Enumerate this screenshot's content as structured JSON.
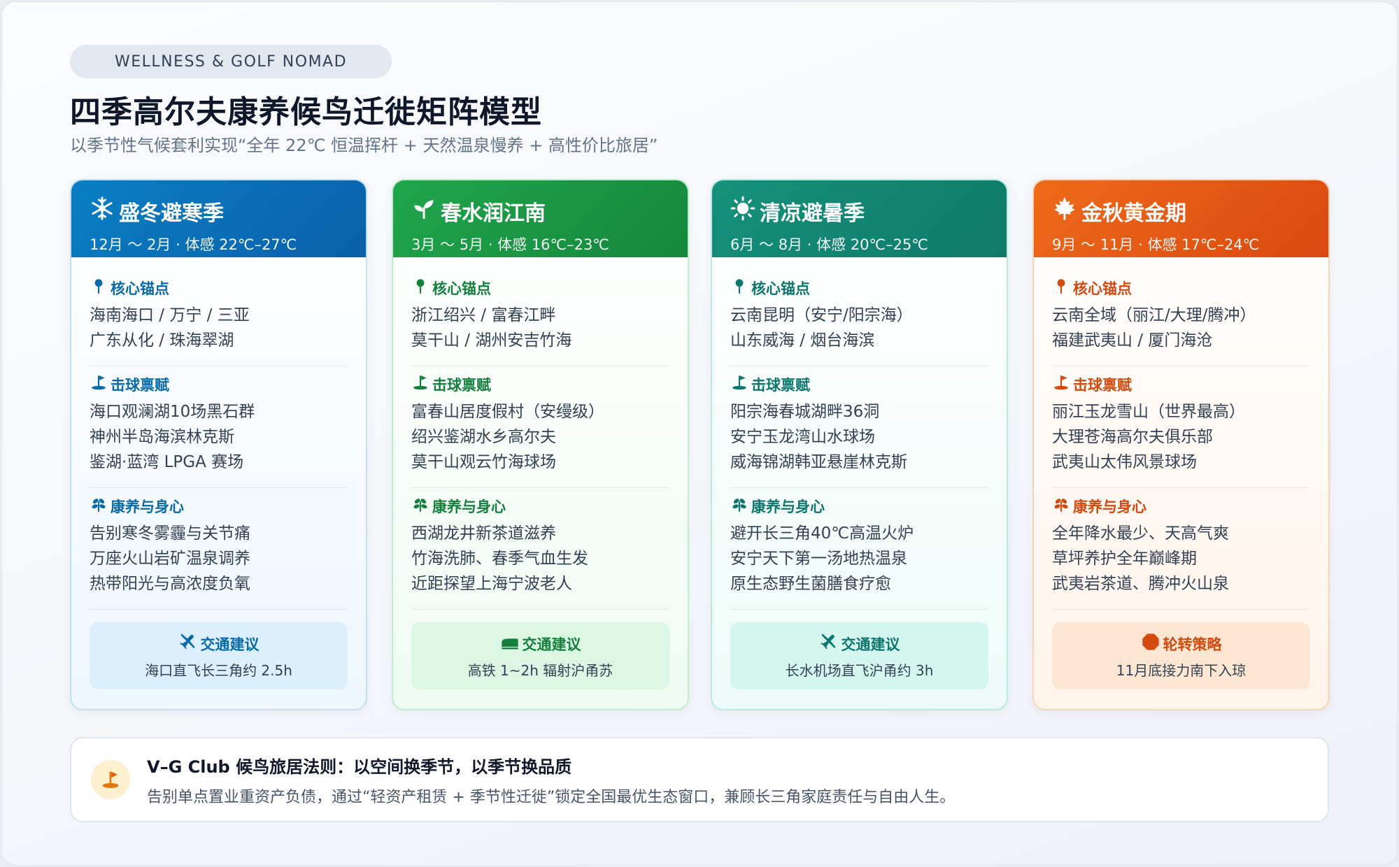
{
  "header": {
    "badge": "WELLNESS & GOLF NOMAD",
    "title": "四季高尔夫康养候鸟迁徙矩阵模型",
    "subtitle": "以季节性气候套利实现“全年 22℃ 恒温挥杆 + 天然温泉慢养 + 高性价比旅居”"
  },
  "colors": {
    "winter": "#0a6aa8",
    "spring": "#15803d",
    "summer": "#0f766e",
    "autumn": "#d24a0e"
  },
  "cards": [
    {
      "icon": "snowflake-icon",
      "title": "盛冬避寒季",
      "range": "12月 ～ 2月 · 体感 22℃–27℃",
      "anchor_label": "核心锚点",
      "anchors": [
        "海南海口 / 万宁 / 三亚",
        "广东从化 / 珠海翠湖"
      ],
      "golf_label": "击球禀赋",
      "golf": [
        "海口观澜湖10场黑石群",
        "神州半岛海滨林克斯",
        "鉴湖·蓝湾 LPGA 赛场"
      ],
      "wellness_label": "康养与身心",
      "wellness": [
        "告别寒冬雾霾与关节痛",
        "万座火山岩矿温泉调养",
        "热带阳光与高浓度负氧"
      ],
      "transport_icon": "plane-icon",
      "transport_label": "交通建议",
      "transport_text": "海口直飞长三角约 2.5h"
    },
    {
      "icon": "sprout-icon",
      "title": "春水润江南",
      "range": "3月 ～ 5月 · 体感 16℃–23℃",
      "anchor_label": "核心锚点",
      "anchors": [
        "浙江绍兴 / 富春江畔",
        "莫干山 / 湖州安吉竹海"
      ],
      "golf_label": "击球禀赋",
      "golf": [
        "富春山居度假村（安缦级）",
        "绍兴鉴湖水乡高尔夫",
        "莫干山观云竹海球场"
      ],
      "wellness_label": "康养与身心",
      "wellness": [
        "西湖龙井新茶道滋养",
        "竹海洗肺、春季气血生发",
        "近距探望上海宁波老人"
      ],
      "transport_icon": "train-icon",
      "transport_label": "交通建议",
      "transport_text": "高铁 1~2h 辐射沪甬苏"
    },
    {
      "icon": "sun-icon",
      "title": "清凉避暑季",
      "range": "6月 ～ 8月 · 体感 20℃–25℃",
      "anchor_label": "核心锚点",
      "anchors": [
        "云南昆明（安宁/阳宗海）",
        "山东威海 / 烟台海滨"
      ],
      "golf_label": "击球禀赋",
      "golf": [
        "阳宗海春城湖畔36洞",
        "安宁玉龙湾山水球场",
        "威海锦湖韩亚悬崖林克斯"
      ],
      "wellness_label": "康养与身心",
      "wellness": [
        "避开长三角40℃高温火炉",
        "安宁天下第一汤地热温泉",
        "原生态野生菌膳食疗愈"
      ],
      "transport_icon": "plane-icon",
      "transport_label": "交通建议",
      "transport_text": "长水机场直飞沪甬约 3h"
    },
    {
      "icon": "maple-leaf-icon",
      "title": "金秋黄金期",
      "range": "9月 ～ 11月 · 体感 17℃–24℃",
      "anchor_label": "核心锚点",
      "anchors": [
        "云南全域（丽江/大理/腾冲）",
        "福建武夷山 / 厦门海沧"
      ],
      "golf_label": "击球禀赋",
      "golf": [
        "丽江玉龙雪山（世界最高）",
        "大理苍海高尔夫俱乐部",
        "武夷山太伟风景球场"
      ],
      "wellness_label": "康养与身心",
      "wellness": [
        "全年降水最少、天高气爽",
        "草坪养护全年巅峰期",
        "武夷岩茶道、腾冲火山泉"
      ],
      "transport_icon": "stop-icon",
      "transport_label": "轮转策略",
      "transport_text": "11月底接力南下入琼"
    }
  ],
  "footer": {
    "icon": "golf-flag-icon",
    "title": "V–G Club 候鸟旅居法则：以空间换季节，以季节换品质",
    "body": "告别单点置业重资产负债，通过“轻资产租赁 + 季节性迁徙”锁定全国最优生态窗口，兼顾长三角家庭责任与自由人生。"
  }
}
